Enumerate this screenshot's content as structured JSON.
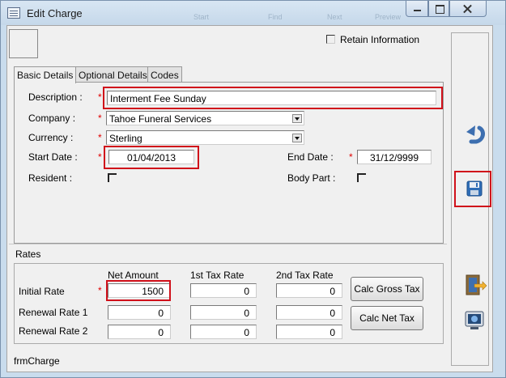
{
  "window": {
    "title": "Edit Charge",
    "ghost_menu": [
      "Start",
      "Find",
      "Next",
      "Preview"
    ]
  },
  "header": {
    "retain_label": "Retain Information",
    "retain_checked": false
  },
  "tabs": [
    {
      "label": "Basic Details",
      "active": true
    },
    {
      "label": "Optional Details",
      "active": false
    },
    {
      "label": "Codes",
      "active": false
    }
  ],
  "basic": {
    "required_mark": "*",
    "description": {
      "label": "Description :",
      "value": "Interment Fee Sunday"
    },
    "company": {
      "label": "Company :",
      "value": "Tahoe Funeral Services"
    },
    "currency": {
      "label": "Currency :",
      "value": "Sterling"
    },
    "start_date": {
      "label": "Start Date :",
      "value": "01/04/2013"
    },
    "end_date": {
      "label": "End Date :",
      "value": "31/12/9999"
    },
    "resident": {
      "label": "Resident :",
      "checked": false
    },
    "body_part": {
      "label": "Body Part :",
      "checked": false
    }
  },
  "rates": {
    "title": "Rates",
    "columns": [
      "Net Amount",
      "1st Tax Rate",
      "2nd Tax Rate"
    ],
    "rows": [
      {
        "label": "Initial Rate",
        "required": true,
        "values": [
          "1500",
          "0",
          "0"
        ]
      },
      {
        "label": "Renewal Rate 1",
        "required": false,
        "values": [
          "0",
          "0",
          "0"
        ]
      },
      {
        "label": "Renewal Rate 2",
        "required": false,
        "values": [
          "0",
          "0",
          "0"
        ]
      }
    ],
    "calc_gross_label": "Calc Gross Tax",
    "calc_net_label": "Calc Net Tax"
  },
  "sidebar": {
    "icons": [
      "undo-icon",
      "save-icon",
      "exit-icon",
      "preview-icon"
    ]
  },
  "footer": {
    "form_name": "frmCharge"
  },
  "colors": {
    "highlight": "#d0101a",
    "required": "#e00000",
    "title_bar": "#c9dced"
  }
}
